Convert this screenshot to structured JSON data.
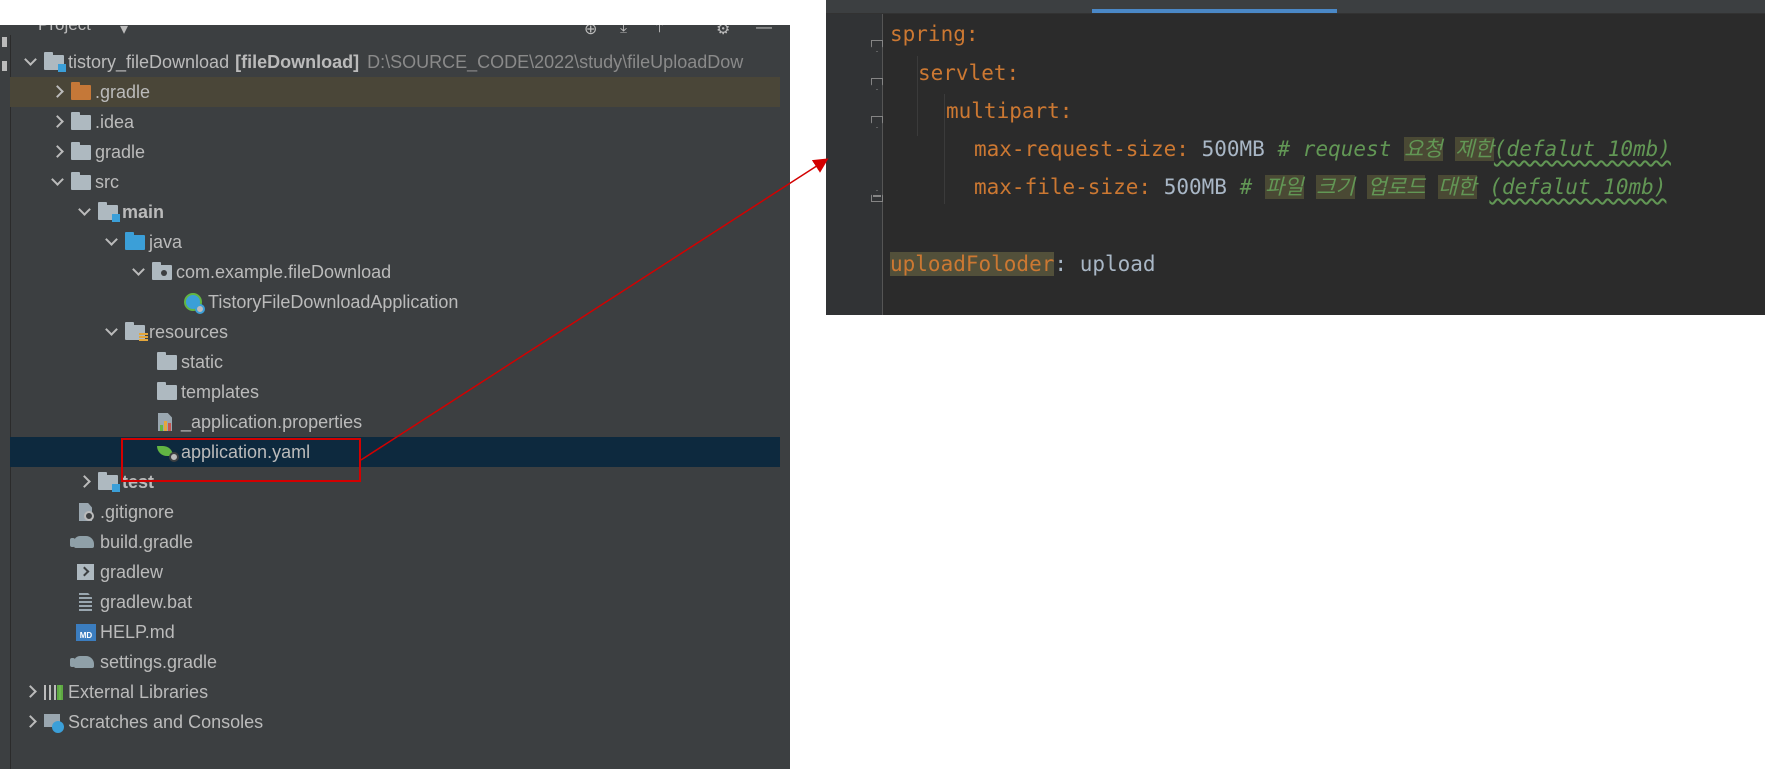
{
  "project_panel": {
    "title": "Project",
    "tree": [
      {
        "label": "tistory_fileDownload",
        "module": "[fileDownload]",
        "path": "D:\\SOURCE_CODE\\2022\\study\\fileUploadDow",
        "indent": 0,
        "expanded": true,
        "icon": "module-folder-icon"
      },
      {
        "label": ".gradle",
        "indent": 1,
        "expanded": false,
        "icon": "folder-orange-icon"
      },
      {
        "label": ".idea",
        "indent": 1,
        "expanded": false,
        "icon": "folder-icon"
      },
      {
        "label": "gradle",
        "indent": 1,
        "expanded": false,
        "icon": "folder-icon"
      },
      {
        "label": "src",
        "indent": 1,
        "expanded": true,
        "icon": "folder-icon"
      },
      {
        "label": "main",
        "indent": 2,
        "expanded": true,
        "icon": "source-root-folder-icon"
      },
      {
        "label": "java",
        "indent": 3,
        "expanded": true,
        "icon": "java-folder-icon"
      },
      {
        "label": "com.example.fileDownload",
        "indent": 4,
        "expanded": true,
        "icon": "package-icon"
      },
      {
        "label": "TistoryFileDownloadApplication",
        "indent": 6,
        "icon": "spring-boot-class-icon"
      },
      {
        "label": "resources",
        "indent": 3,
        "expanded": true,
        "icon": "resources-folder-icon"
      },
      {
        "label": "static",
        "indent": 5,
        "icon": "folder-icon"
      },
      {
        "label": "templates",
        "indent": 5,
        "icon": "folder-icon"
      },
      {
        "label": "_application.properties",
        "indent": 5,
        "icon": "properties-file-icon"
      },
      {
        "label": "application.yaml",
        "indent": 5,
        "icon": "yaml-spring-file-icon",
        "selected": true
      },
      {
        "label": "test",
        "indent": 2,
        "expanded": false,
        "icon": "test-folder-icon"
      },
      {
        "label": ".gitignore",
        "indent": 2,
        "icon": "gitignore-file-icon"
      },
      {
        "label": "build.gradle",
        "indent": 2,
        "icon": "gradle-elephant-icon"
      },
      {
        "label": "gradlew",
        "indent": 2,
        "icon": "terminal-file-icon"
      },
      {
        "label": "gradlew.bat",
        "indent": 2,
        "icon": "text-file-icon"
      },
      {
        "label": "HELP.md",
        "indent": 2,
        "icon": "markdown-file-icon"
      },
      {
        "label": "settings.gradle",
        "indent": 2,
        "icon": "gradle-elephant-icon"
      },
      {
        "label": "External Libraries",
        "indent": 0,
        "expanded": false,
        "icon": "libraries-icon"
      },
      {
        "label": "Scratches and Consoles",
        "indent": 0,
        "expanded": false,
        "icon": "scratches-icon"
      }
    ]
  },
  "editor": {
    "lines": [
      {
        "key": "spring",
        "colon": ":"
      },
      {
        "key": "servlet",
        "colon": ":"
      },
      {
        "key": "multipart",
        "colon": ":"
      },
      {
        "key": "max-request-size",
        "colon": ":",
        "value": "500MB",
        "comment_hash": "#",
        "comment_word1": "request",
        "comment_k1": "요청",
        "comment_k2": "제한",
        "comment_tail": "(defalut 10mb)"
      },
      {
        "key": "max-file-size",
        "colon": ":",
        "value": "500MB",
        "comment_hash": "#",
        "comment_k1": "파일",
        "comment_k2": "크기",
        "comment_k3": "업로드",
        "comment_k4": "대한",
        "comment_tail": "(defalut 10mb)"
      },
      {
        "key": "uploadFoloder",
        "colon": ":",
        "value": "upload"
      }
    ]
  },
  "colors": {
    "panel_bg": "#3c3f41",
    "editor_bg": "#2b2b2b",
    "selection_bg": "#0d293e",
    "yaml_key": "#cc7832",
    "comment": "#629755",
    "callout": "#d30000"
  }
}
